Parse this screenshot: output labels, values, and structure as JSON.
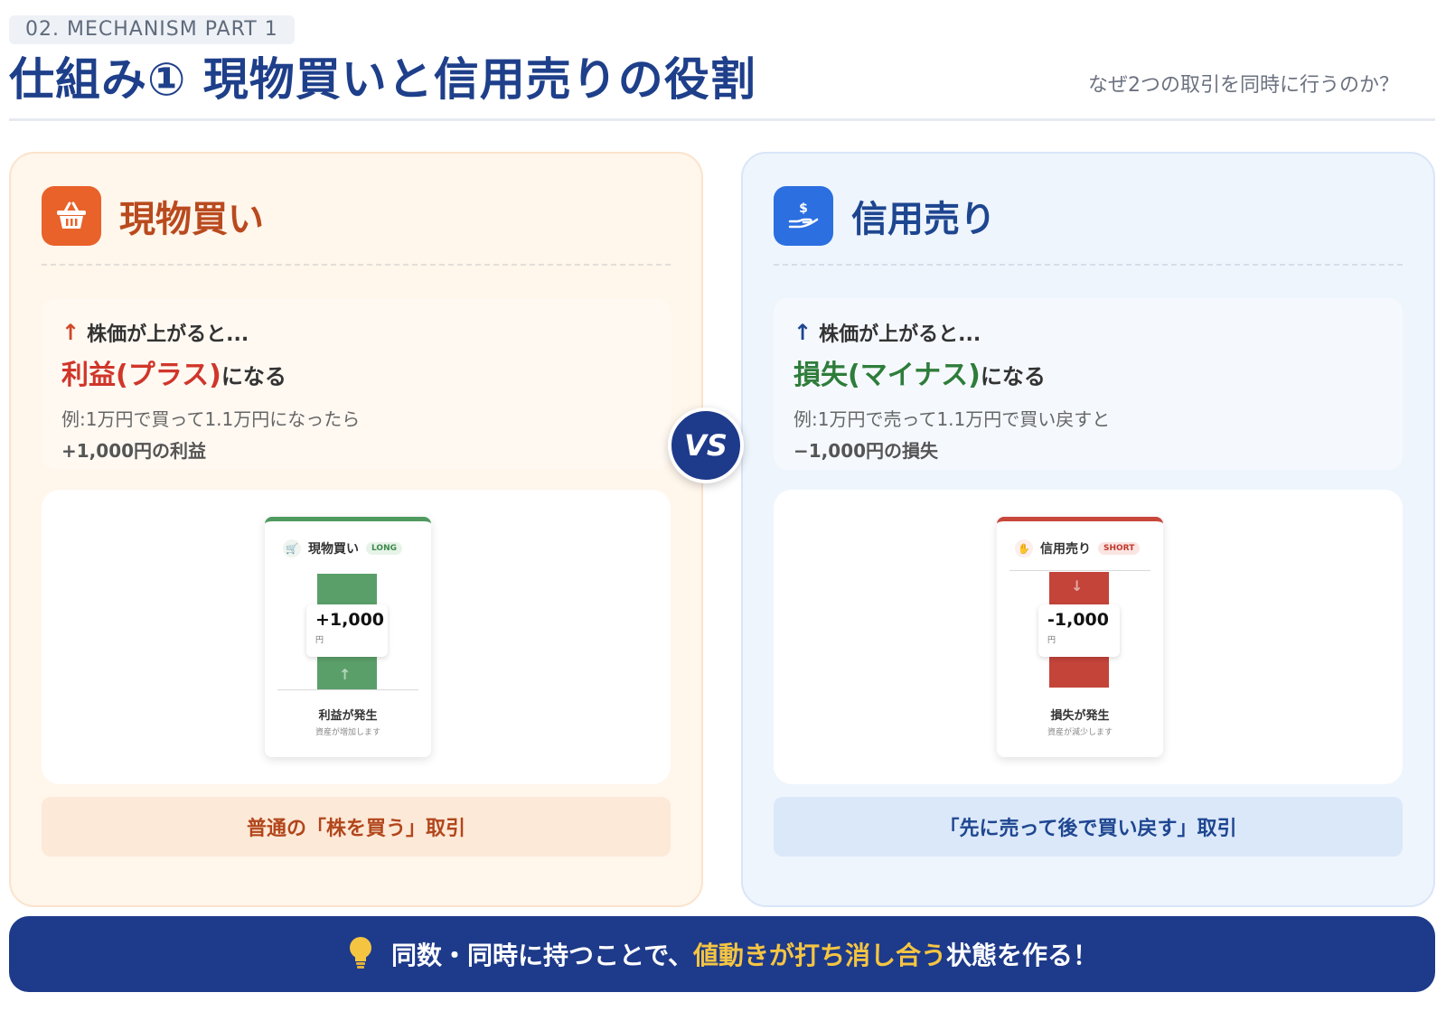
{
  "header": {
    "eyebrow": "02. MECHANISM PART 1",
    "title": "仕組み① 現物買いと信用売りの役割",
    "subtitle": "なぜ2つの取引を同時に行うのか？"
  },
  "left": {
    "title": "現物買い",
    "icon": "basket-icon",
    "condition": "株価が上がると...",
    "result_highlight": "利益(プラス)",
    "result_suffix": "になる",
    "example_line1": "例:1万円で買って1.1万円になったら",
    "example_line2": "+1,000円の利益",
    "mini": {
      "title": "現物買い",
      "tag": "LONG",
      "value": "+1,000",
      "unit": "円",
      "caption": "利益が発生",
      "sub": "資産が増加します"
    },
    "footer": "普通の「株を買う」取引"
  },
  "right": {
    "title": "信用売り",
    "icon": "hand-money-icon",
    "condition": "株価が上がると...",
    "result_highlight": "損失(マイナス)",
    "result_suffix": "になる",
    "example_line1": "例:1万円で売って1.1万円で買い戻すと",
    "example_line2": "−1,000円の損失",
    "mini": {
      "title": "信用売り",
      "tag": "SHORT",
      "value": "-1,000",
      "unit": "円",
      "caption": "損失が発生",
      "sub": "資産が減少します"
    },
    "footer": "「先に売って後で買い戻す」取引"
  },
  "vs_label": "VS",
  "banner": {
    "icon": "lightbulb-icon",
    "text_before": "同数・同時に持つことで、",
    "text_highlight": "値動きが打ち消し合う",
    "text_after": "状態を作る！"
  },
  "colors": {
    "navy": "#1e3a8a",
    "orange": "#e8622a",
    "blue": "#2b6fe0",
    "profit_green": "#5a9f6a",
    "loss_red": "#c4443a",
    "highlight_yellow": "#f5c542"
  }
}
